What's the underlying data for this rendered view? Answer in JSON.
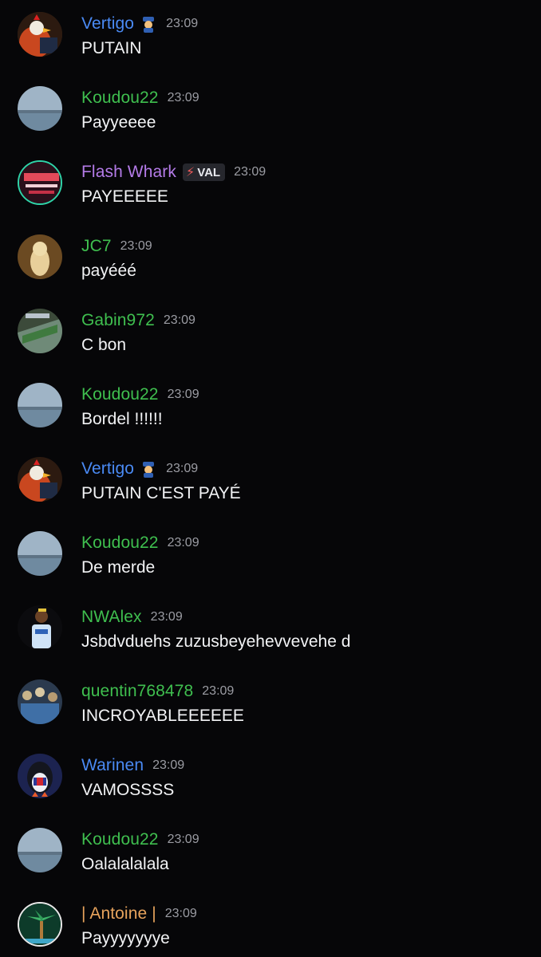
{
  "colors": {
    "background": "#060608",
    "timestamp": "#9b9ca3",
    "name_blue": "#4a8af4",
    "name_green": "#3fbf4f",
    "name_purple": "#b47be8",
    "name_orange": "#e7a35c"
  },
  "messages": [
    {
      "author": "Vertigo",
      "time": "23:09",
      "text": "PUTAIN",
      "badge_icon": "police-officer-icon"
    },
    {
      "author": "Koudou22",
      "time": "23:09",
      "text": "Payyeeee"
    },
    {
      "author": "Flash Whark",
      "time": "23:09",
      "text": "PAYEEEEE",
      "role_tag": "VAL",
      "role_icon": "lightning-icon"
    },
    {
      "author": "JC7",
      "time": "23:09",
      "text": "payééé"
    },
    {
      "author": "Gabin972",
      "time": "23:09",
      "text": "C bon"
    },
    {
      "author": "Koudou22",
      "time": "23:09",
      "text": "Bordel !!!!!!"
    },
    {
      "author": "Vertigo",
      "time": "23:09",
      "text": "PUTAIN C'EST PAYÉ",
      "badge_icon": "police-officer-icon"
    },
    {
      "author": "Koudou22",
      "time": "23:09",
      "text": "De merde"
    },
    {
      "author": "NWAlex",
      "time": "23:09",
      "text": "Jsbdvduehs zuzusbeyehevvevehe d"
    },
    {
      "author": "quentin768478",
      "time": "23:09",
      "text": "INCROYABLEEEEEE"
    },
    {
      "author": "Warinen",
      "time": "23:09",
      "text": "VAMOSSSS"
    },
    {
      "author": "Koudou22",
      "time": "23:09",
      "text": "Oalalalalala"
    },
    {
      "author": "| Antoine |",
      "time": "23:09",
      "text": "Payyyyyyye"
    }
  ]
}
